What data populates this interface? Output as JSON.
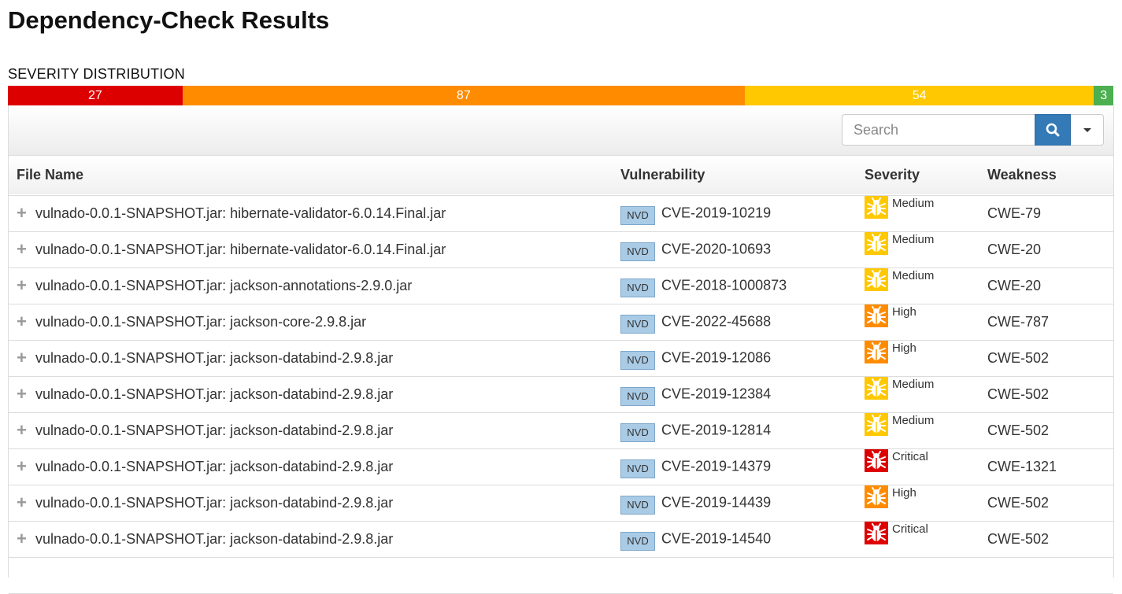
{
  "page": {
    "title": "Dependency-Check Results"
  },
  "distribution": {
    "label": "SEVERITY DISTRIBUTION",
    "segments": [
      {
        "severity": "critical",
        "count": "27",
        "color": "#dd0000"
      },
      {
        "severity": "high",
        "count": "87",
        "color": "#ff8c00"
      },
      {
        "severity": "medium",
        "count": "54",
        "color": "#ffc800"
      },
      {
        "severity": "low",
        "count": "3",
        "color": "#4caf50"
      }
    ]
  },
  "toolbar": {
    "search_placeholder": "Search",
    "search_icon": "search-icon",
    "dropdown_icon": "caret-down-icon"
  },
  "table": {
    "headers": {
      "file": "File Name",
      "vuln": "Vulnerability",
      "severity": "Severity",
      "weakness": "Weakness"
    },
    "source_label": "NVD",
    "severity_colors": {
      "Critical": "#dd0000",
      "High": "#ff8c00",
      "Medium": "#ffc800"
    },
    "rows": [
      {
        "file": "vulnado-0.0.1-SNAPSHOT.jar: hibernate-validator-6.0.14.Final.jar",
        "cve": "CVE-2019-10219",
        "severity": "Medium",
        "weakness": "CWE-79"
      },
      {
        "file": "vulnado-0.0.1-SNAPSHOT.jar: hibernate-validator-6.0.14.Final.jar",
        "cve": "CVE-2020-10693",
        "severity": "Medium",
        "weakness": "CWE-20"
      },
      {
        "file": "vulnado-0.0.1-SNAPSHOT.jar: jackson-annotations-2.9.0.jar",
        "cve": "CVE-2018-1000873",
        "severity": "Medium",
        "weakness": "CWE-20"
      },
      {
        "file": "vulnado-0.0.1-SNAPSHOT.jar: jackson-core-2.9.8.jar",
        "cve": "CVE-2022-45688",
        "severity": "High",
        "weakness": "CWE-787"
      },
      {
        "file": "vulnado-0.0.1-SNAPSHOT.jar: jackson-databind-2.9.8.jar",
        "cve": "CVE-2019-12086",
        "severity": "High",
        "weakness": "CWE-502"
      },
      {
        "file": "vulnado-0.0.1-SNAPSHOT.jar: jackson-databind-2.9.8.jar",
        "cve": "CVE-2019-12384",
        "severity": "Medium",
        "weakness": "CWE-502"
      },
      {
        "file": "vulnado-0.0.1-SNAPSHOT.jar: jackson-databind-2.9.8.jar",
        "cve": "CVE-2019-12814",
        "severity": "Medium",
        "weakness": "CWE-502"
      },
      {
        "file": "vulnado-0.0.1-SNAPSHOT.jar: jackson-databind-2.9.8.jar",
        "cve": "CVE-2019-14379",
        "severity": "Critical",
        "weakness": "CWE-1321"
      },
      {
        "file": "vulnado-0.0.1-SNAPSHOT.jar: jackson-databind-2.9.8.jar",
        "cve": "CVE-2019-14439",
        "severity": "High",
        "weakness": "CWE-502"
      },
      {
        "file": "vulnado-0.0.1-SNAPSHOT.jar: jackson-databind-2.9.8.jar",
        "cve": "CVE-2019-14540",
        "severity": "Critical",
        "weakness": "CWE-502"
      },
      {
        "file": "",
        "cve": "",
        "severity": "",
        "weakness": ""
      }
    ]
  }
}
